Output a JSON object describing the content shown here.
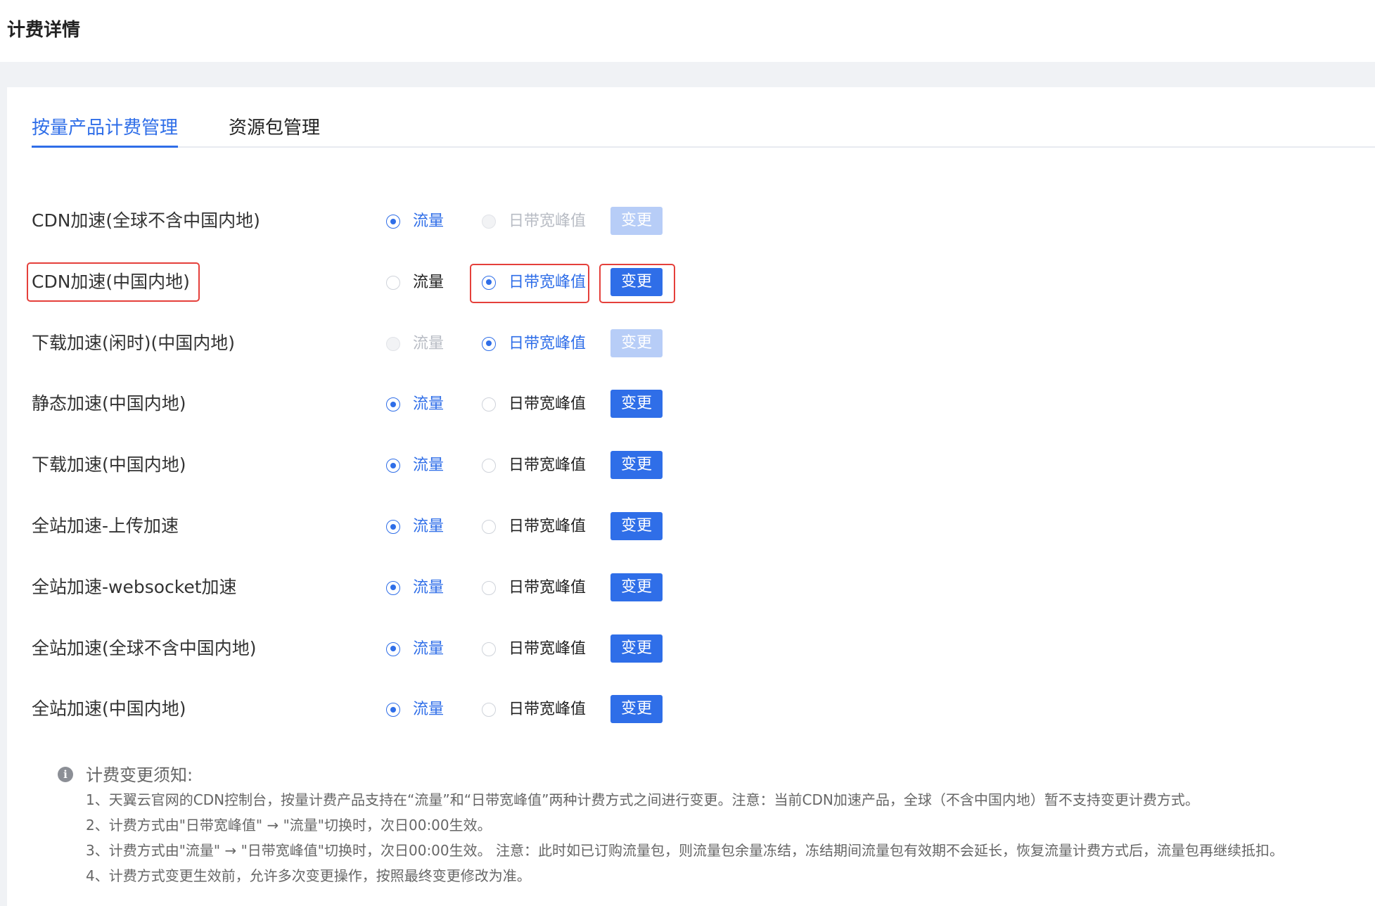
{
  "header": {
    "title": "计费详情"
  },
  "tabs": [
    {
      "label": "按量产品计费管理",
      "active": true
    },
    {
      "label": "资源包管理",
      "active": false
    }
  ],
  "option_labels": {
    "traffic": "流量",
    "bandwidth": "日带宽峰值"
  },
  "change_label": "变更",
  "rows": [
    {
      "name": "CDN加速(全球不含中国内地)",
      "selected": "traffic",
      "traffic_disabled": false,
      "bandwidth_disabled": true,
      "button_disabled": true,
      "highlighted": false
    },
    {
      "name": "CDN加速(中国内地)",
      "selected": "bandwidth",
      "traffic_disabled": false,
      "bandwidth_disabled": false,
      "button_disabled": false,
      "highlighted": true
    },
    {
      "name": "下载加速(闲时)(中国内地)",
      "selected": "bandwidth",
      "traffic_disabled": true,
      "bandwidth_disabled": false,
      "button_disabled": true,
      "highlighted": false
    },
    {
      "name": "静态加速(中国内地)",
      "selected": "traffic",
      "traffic_disabled": false,
      "bandwidth_disabled": false,
      "button_disabled": false,
      "highlighted": false
    },
    {
      "name": "下载加速(中国内地)",
      "selected": "traffic",
      "traffic_disabled": false,
      "bandwidth_disabled": false,
      "button_disabled": false,
      "highlighted": false
    },
    {
      "name": "全站加速-上传加速",
      "selected": "traffic",
      "traffic_disabled": false,
      "bandwidth_disabled": false,
      "button_disabled": false,
      "highlighted": false
    },
    {
      "name": "全站加速-websocket加速",
      "selected": "traffic",
      "traffic_disabled": false,
      "bandwidth_disabled": false,
      "button_disabled": false,
      "highlighted": false
    },
    {
      "name": "全站加速(全球不含中国内地)",
      "selected": "traffic",
      "traffic_disabled": false,
      "bandwidth_disabled": false,
      "button_disabled": false,
      "highlighted": false
    },
    {
      "name": "全站加速(中国内地)",
      "selected": "traffic",
      "traffic_disabled": false,
      "bandwidth_disabled": false,
      "button_disabled": false,
      "highlighted": false
    }
  ],
  "notice": {
    "icon": "info-icon",
    "title": "计费变更须知:",
    "lines": [
      "1、天翼云官网的CDN控制台，按量计费产品支持在“流量”和“日带宽峰值”两种计费方式之间进行变更。注意：当前CDN加速产品，全球（不含中国内地）暂不支持变更计费方式。",
      "2、计费方式由\"日带宽峰值\" → \"流量\"切换时，次日00:00生效。",
      "3、计费方式由\"流量\" → \"日带宽峰值\"切换时，次日00:00生效。 注意：此时如已订购流量包，则流量包余量冻结，冻结期间流量包有效期不会延长，恢复流量计费方式后，流量包再继续抵扣。",
      "4、计费方式变更生效前，允许多次变更操作，按照最终变更修改为准。"
    ]
  },
  "colors": {
    "primary": "#2f6ee8",
    "highlight_border": "#e5403b",
    "disabled_button": "#b7cdf7"
  }
}
